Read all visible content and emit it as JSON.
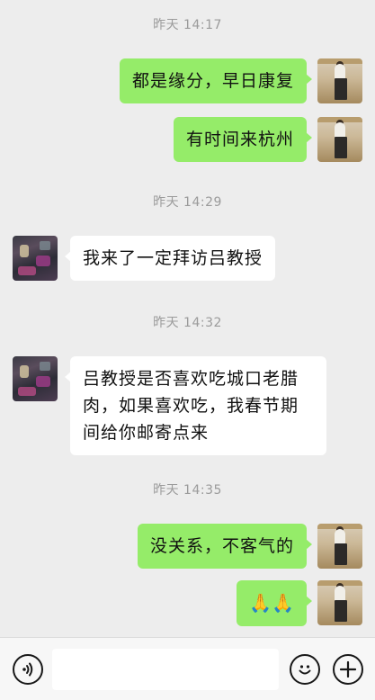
{
  "messages": {
    "ts1": "昨天 14:17",
    "m1": "都是缘分，早日康复",
    "m2": "有时间来杭州",
    "ts2": "昨天 14:29",
    "m3": "我来了一定拜访吕教授",
    "ts3": "昨天 14:32",
    "m4_line1": "吕教授是否喜欢吃城口老腊",
    "m4_line2": "肉，如果喜欢吃，我春节期",
    "m4_line3": "间给你邮寄点来",
    "ts4": "昨天 14:35",
    "m5": "没关系，不客气的",
    "m6": "🙏🙏"
  },
  "input_bar": {
    "voice_icon": "voice-icon",
    "emoji_icon": "emoji-icon",
    "plus_icon": "plus-icon",
    "placeholder": ""
  },
  "colors": {
    "background": "#ededed",
    "sent_bubble": "#95ec69",
    "received_bubble": "#ffffff",
    "timestamp": "#9b9b9b"
  }
}
